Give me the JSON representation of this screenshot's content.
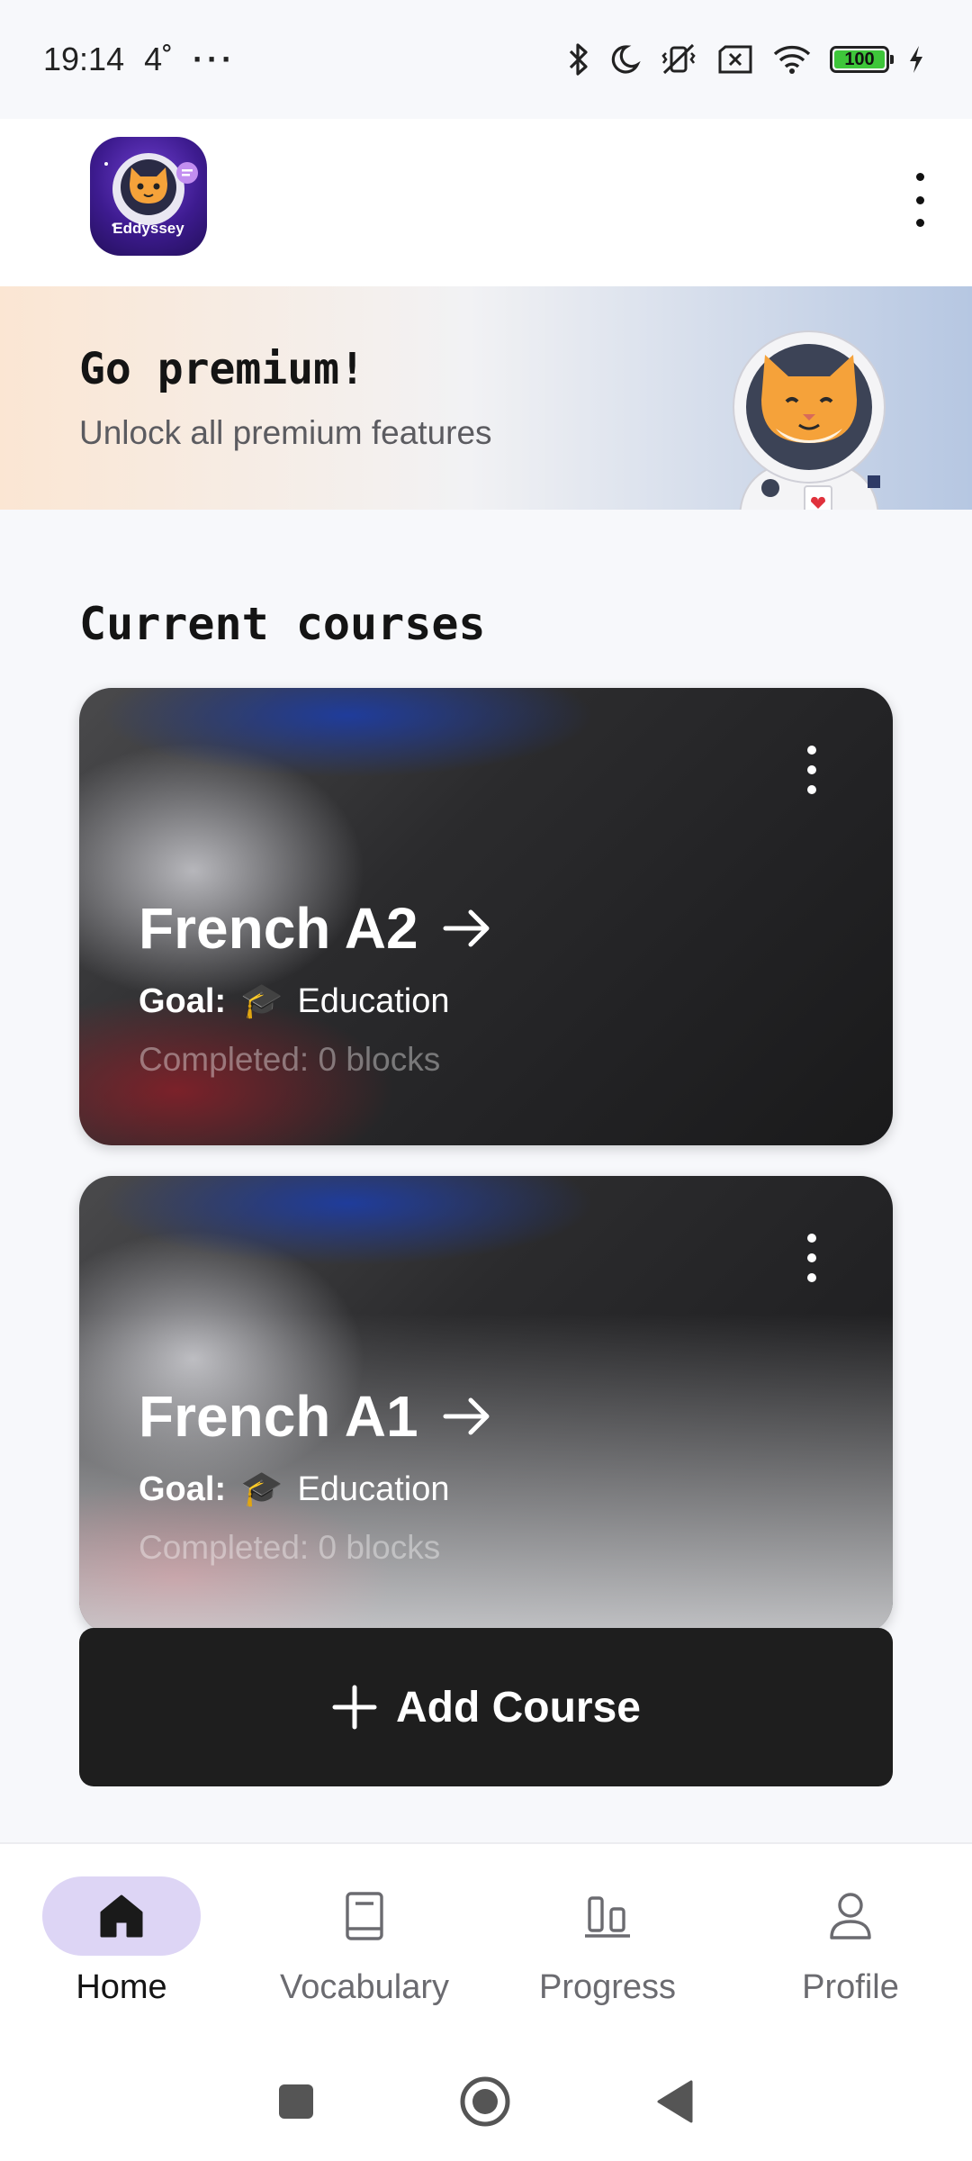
{
  "status_bar": {
    "time": "19:14",
    "temperature": "4˚",
    "more": "···",
    "battery_level": "100"
  },
  "header": {
    "logo_text": "Eddyssey"
  },
  "premium": {
    "title": "Go premium!",
    "subtitle": "Unlock all premium features"
  },
  "courses_section": {
    "title": "Current courses",
    "items": [
      {
        "title": "French A2",
        "goal_label": "Goal:",
        "goal_icon": "🎓",
        "goal_value": "Education",
        "completed": "Completed: 0 blocks"
      },
      {
        "title": "French A1",
        "goal_label": "Goal:",
        "goal_icon": "🎓",
        "goal_value": "Education",
        "completed": "Completed: 0 blocks"
      }
    ]
  },
  "add_course": {
    "label": "Add Course"
  },
  "bottom_nav": {
    "items": [
      {
        "label": "Home",
        "icon": "home-icon",
        "active": true
      },
      {
        "label": "Vocabulary",
        "icon": "book-icon",
        "active": false
      },
      {
        "label": "Progress",
        "icon": "bar-chart-icon",
        "active": false
      },
      {
        "label": "Profile",
        "icon": "person-icon",
        "active": false
      }
    ]
  },
  "colors": {
    "nav_active_pill": "#ddd5f5",
    "add_button_bg": "#1e1e1e",
    "battery_fill": "#3ec63a"
  }
}
